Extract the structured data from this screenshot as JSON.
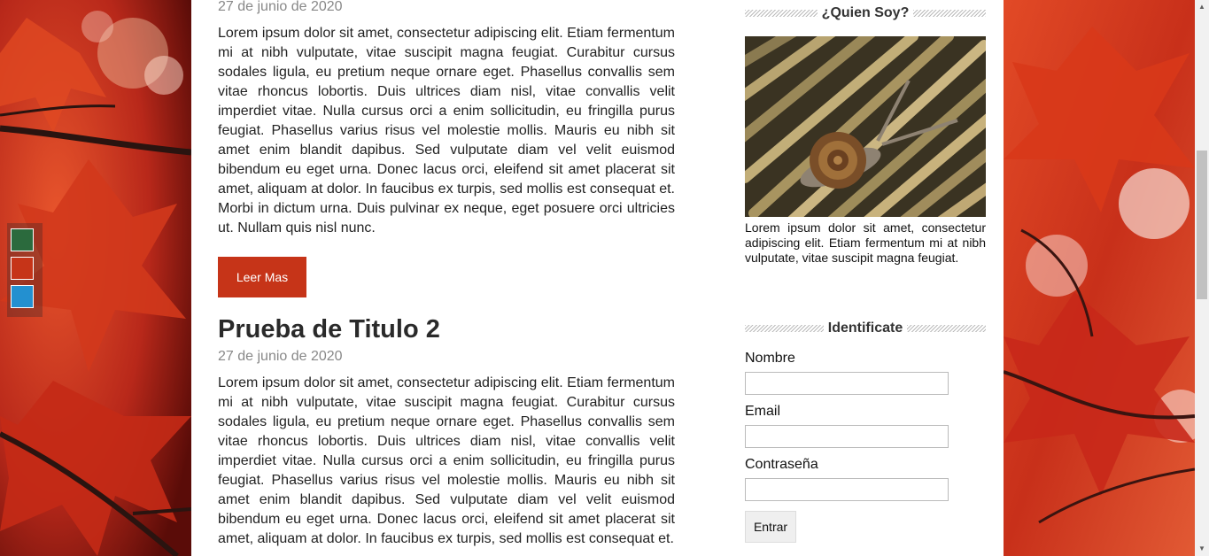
{
  "colors": {
    "switcher_green": "#2b6a3d",
    "switcher_red": "#c63418",
    "switcher_blue": "#2390d0",
    "button_accent": "#c63418"
  },
  "posts": [
    {
      "date": "27 de junio de 2020",
      "body": "Lorem ipsum dolor sit amet, consectetur adipiscing elit. Etiam fermentum mi at nibh vulputate, vitae suscipit magna feugiat. Curabitur cursus sodales ligula, eu pretium neque ornare eget. Phasellus convallis sem vitae rhoncus lobortis. Duis ultrices diam nisl, vitae convallis velit imperdiet vitae. Nulla cursus orci a enim sollicitudin, eu fringilla purus feugiat. Phasellus varius risus vel molestie mollis. Mauris eu nibh sit amet enim blandit dapibus. Sed vulputate diam vel velit euismod bibendum eu eget urna. Donec lacus orci, eleifend sit amet placerat sit amet, aliquam at dolor. In faucibus ex turpis, sed mollis est consequat et. Morbi in dictum urna. Duis pulvinar ex neque, eget posuere orci ultricies ut. Nullam quis nisl nunc.",
      "read_more": "Leer Mas"
    },
    {
      "title": "Prueba de Titulo 2",
      "date": "27 de junio de 2020",
      "body": "Lorem ipsum dolor sit amet, consectetur adipiscing elit. Etiam fermentum mi at nibh vulputate, vitae suscipit magna feugiat. Curabitur cursus sodales ligula, eu pretium neque ornare eget. Phasellus convallis sem vitae rhoncus lobortis. Duis ultrices diam nisl, vitae convallis velit imperdiet vitae. Nulla cursus orci a enim sollicitudin, eu fringilla purus feugiat. Phasellus varius risus vel molestie mollis. Mauris eu nibh sit amet enim blandit dapibus. Sed vulputate diam vel velit euismod bibendum eu eget urna. Donec lacus orci, eleifend sit amet placerat sit amet, aliquam at dolor. In faucibus ex turpis, sed mollis est consequat et."
    }
  ],
  "sidebar": {
    "about": {
      "title": "¿Quien Soy?",
      "text": "Lorem ipsum dolor sit amet, consectetur adipiscing elit. Etiam fermentum mi at nibh vulputate, vitae suscipit magna feugiat."
    },
    "login": {
      "title": "Identificate",
      "name_label": "Nombre",
      "name_value": "",
      "email_label": "Email",
      "email_value": "",
      "password_label": "Contraseña",
      "password_value": "",
      "submit_label": "Entrar"
    }
  },
  "icons": {
    "scroll_up": "▲",
    "scroll_down": "▼"
  }
}
